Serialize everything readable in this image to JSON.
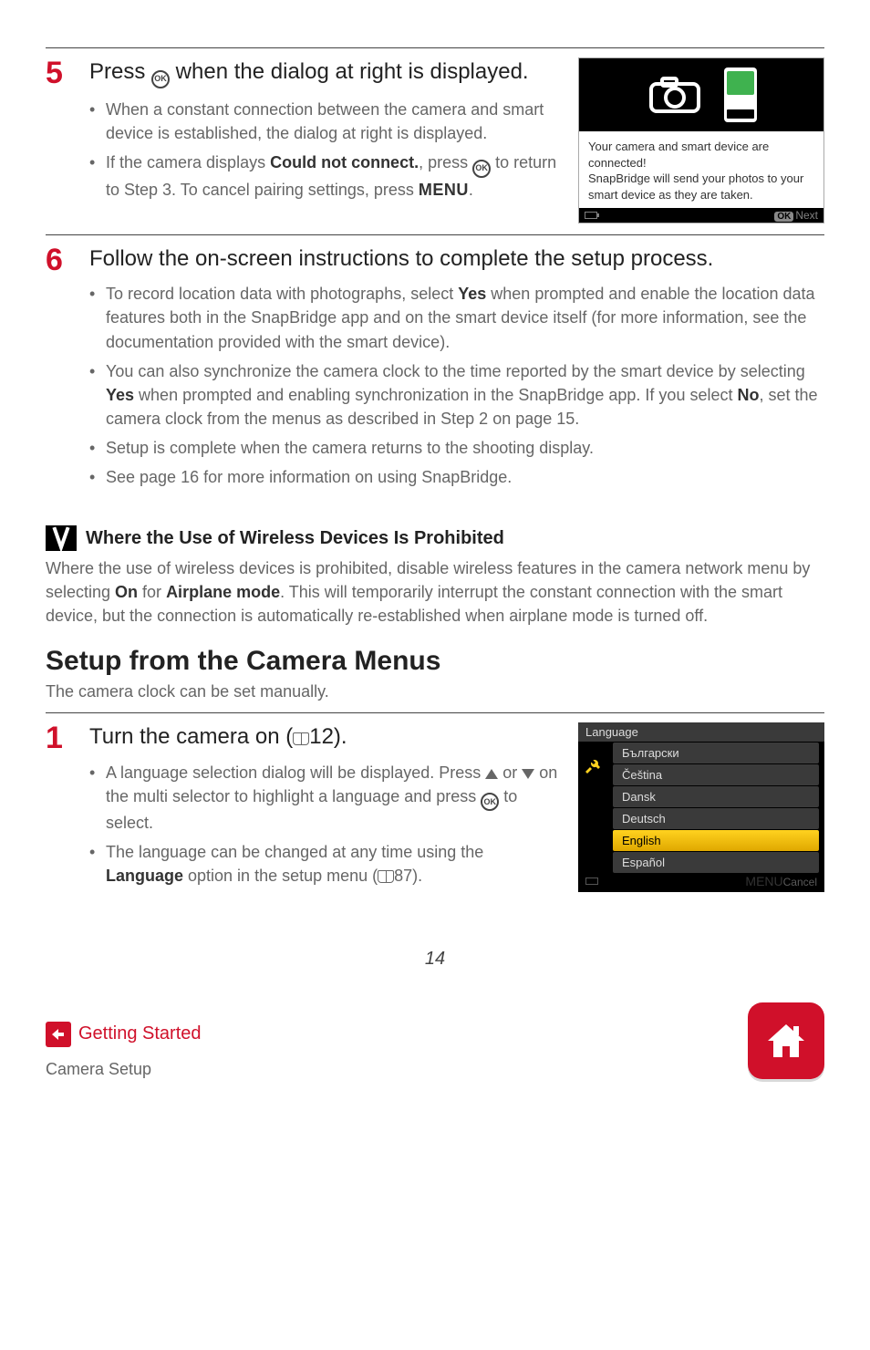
{
  "step5": {
    "num": "5",
    "heading_a": "Press ",
    "heading_b": " when the dialog at right is displayed.",
    "b1": "When a constant connection between the camera and smart device is established, the dialog at right is displayed.",
    "b2_a": "If the camera displays ",
    "b2_bold": "Could not connect.",
    "b2_b": ", press ",
    "b2_c": " to return to Step 3. To cancel pairing settings, press ",
    "b2_d": "."
  },
  "menu_word": "MENU",
  "connect_box": {
    "line1": "Your camera and smart device are connected!",
    "line2": "SnapBridge will send your photos to your smart device as they are taken.",
    "next": "Next",
    "ok": "OK"
  },
  "step6": {
    "num": "6",
    "heading": "Follow the on-screen instructions to complete the setup process.",
    "b1_a": "To record location data with photographs, select ",
    "b1_yes": "Yes",
    "b1_b": " when prompted and enable the location data features both in the SnapBridge app and on the smart device itself (for more information, see the documentation provided with the smart device).",
    "b2_a": "You can also synchronize the camera clock to the time reported by the smart device by selecting ",
    "b2_yes": "Yes",
    "b2_b": " when prompted and enabling synchronization in the SnapBridge app. If you select ",
    "b2_no": "No",
    "b2_c": ", set the camera clock from the menus as described in Step 2 on page 15.",
    "b3": "Setup is complete when the camera returns to the shooting display.",
    "b4": "See page 16 for more information on using SnapBridge."
  },
  "note": {
    "title": "Where the Use of Wireless Devices Is Prohibited",
    "body_a": "Where the use of wireless devices is prohibited, disable wireless features in the camera network menu by selecting ",
    "on": "On",
    "body_b": " for ",
    "airplane": "Airplane mode",
    "body_c": ". This will temporarily interrupt the constant connection with the smart device, but the connection is automatically re-established when airplane mode is turned off."
  },
  "setup_section": {
    "title": "Setup from the Camera Menus",
    "sub": "The camera clock can be set manually."
  },
  "step1": {
    "num": "1",
    "heading_a": "Turn the camera on (",
    "heading_b": "12).",
    "b1_a": "A language selection dialog will be displayed. Press ",
    "b1_b": " or ",
    "b1_c": " on the multi selector to highlight a language and press ",
    "b1_d": " to select.",
    "b2_a": "The language can be changed at any time using the ",
    "b2_lang": "Language",
    "b2_b": " option in the setup menu (",
    "b2_c": "87)."
  },
  "lang_list": {
    "header": "Language",
    "items": [
      "Български",
      "Čeština",
      "Dansk",
      "Deutsch",
      "English",
      "Español"
    ],
    "selected_index": 4,
    "cancel": "Cancel",
    "menu": "MENU"
  },
  "page_number": "14",
  "footer": {
    "getting_started": "Getting Started",
    "camera_setup": "Camera Setup"
  }
}
